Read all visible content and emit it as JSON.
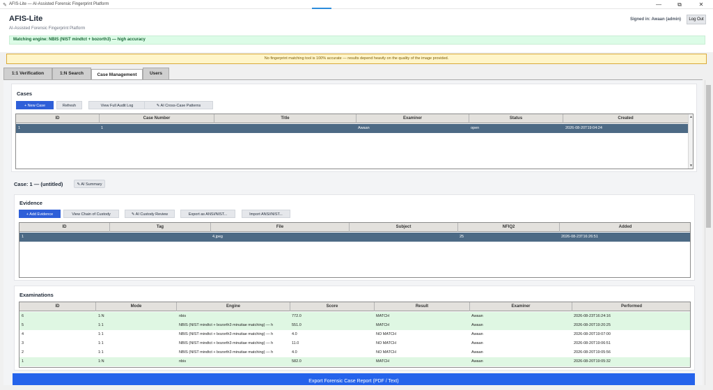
{
  "window": {
    "title": "AFIS-Lite — AI-Assisted Forensic Fingerprint Platform",
    "controls": [
      "—",
      "⧉",
      "✕"
    ]
  },
  "header": {
    "app_title": "AFIS-Lite",
    "subtitle": "AI-Assisted Forensic Fingerprint Platform",
    "signed_in": "Signed in: Awaan (admin)",
    "logout_label": "Log Out",
    "engine_status": "Matching engine: NBIS (NIST mindtct + bozorth3) — high accuracy"
  },
  "warning": "No fingerprint matching tool is 100% accurate — results depend heavily on the quality of the image provided.",
  "tabs": [
    {
      "label": "1:1 Verification",
      "active": false
    },
    {
      "label": "1:N Search",
      "active": false
    },
    {
      "label": "Case Management",
      "active": true
    },
    {
      "label": "Users",
      "active": false
    }
  ],
  "cases": {
    "title": "Cases",
    "buttons": {
      "new_case": "+ New Case",
      "refresh": "Refresh",
      "audit_log": "View Full Audit Log",
      "ai_patterns": "✎ AI Cross-Case Patterns"
    },
    "columns": [
      "ID",
      "Case Number",
      "Title",
      "Examiner",
      "Status",
      "Created"
    ],
    "rows": [
      {
        "id": "1",
        "case_number": "1",
        "title": "",
        "examiner": "Awaan",
        "status": "open",
        "created": "2026-08-20T19:04:24"
      }
    ]
  },
  "case_detail": {
    "heading": "Case: 1 — (untitled)",
    "ai_summary": "✎ AI Summary"
  },
  "evidence": {
    "title": "Evidence",
    "buttons": {
      "add": "+ Add Evidence",
      "chain": "View Chain of Custody",
      "ai_custody": "✎ AI Custody Review",
      "export": "Export as ANSI/NIST...",
      "import": "Import ANSI/NIST..."
    },
    "columns": [
      "ID",
      "Tag",
      "File",
      "Subject",
      "NFIQ2",
      "Added"
    ],
    "rows": [
      {
        "id": "1",
        "tag": "",
        "file": "4.jpeg",
        "subject": "",
        "nfiq2": "25",
        "added": "2026-08-23T16:26:51"
      }
    ]
  },
  "examinations": {
    "title": "Examinations",
    "columns": [
      "ID",
      "Mode",
      "Engine",
      "Score",
      "Result",
      "Examiner",
      "Performed"
    ],
    "rows": [
      {
        "id": "6",
        "mode": "1:N",
        "engine": "nbis",
        "score": "772.0",
        "result": "MATCH",
        "examiner": "Awaan",
        "performed": "2026-08-23T16:24:16"
      },
      {
        "id": "5",
        "mode": "1:1",
        "engine": "NBIS (NIST mindtct + bozorth3 minutiae matching) — h",
        "score": "551.0",
        "result": "MATCH",
        "examiner": "Awaan",
        "performed": "2026-08-20T19:20:25"
      },
      {
        "id": "4",
        "mode": "1:1",
        "engine": "NBIS (NIST mindtct + bozorth3 minutiae matching) — h",
        "score": "4.0",
        "result": "NO MATCH",
        "examiner": "Awaan",
        "performed": "2026-08-20T19:07:00"
      },
      {
        "id": "3",
        "mode": "1:1",
        "engine": "NBIS (NIST mindtct + bozorth3 minutiae matching) — h",
        "score": "11.0",
        "result": "NO MATCH",
        "examiner": "Awaan",
        "performed": "2026-08-20T19:06:51"
      },
      {
        "id": "2",
        "mode": "1:1",
        "engine": "NBIS (NIST mindtct + bozorth3 minutiae matching) — h",
        "score": "4.0",
        "result": "NO MATCH",
        "examiner": "Awaan",
        "performed": "2026-08-20T19:05:56"
      },
      {
        "id": "1",
        "mode": "1:N",
        "engine": "nbis",
        "score": "582.0",
        "result": "MATCH",
        "examiner": "Awaan",
        "performed": "2026-08-20T19:05:32"
      }
    ]
  },
  "export_button": "Export Forensic Case Report (PDF / Text)",
  "colors": {
    "primary": "#2563eb",
    "selected_row": "#4d6a85",
    "match_row": "#dff7e3",
    "engine_bg": "#dcfce7",
    "warning_bg": "#fff5c9"
  }
}
